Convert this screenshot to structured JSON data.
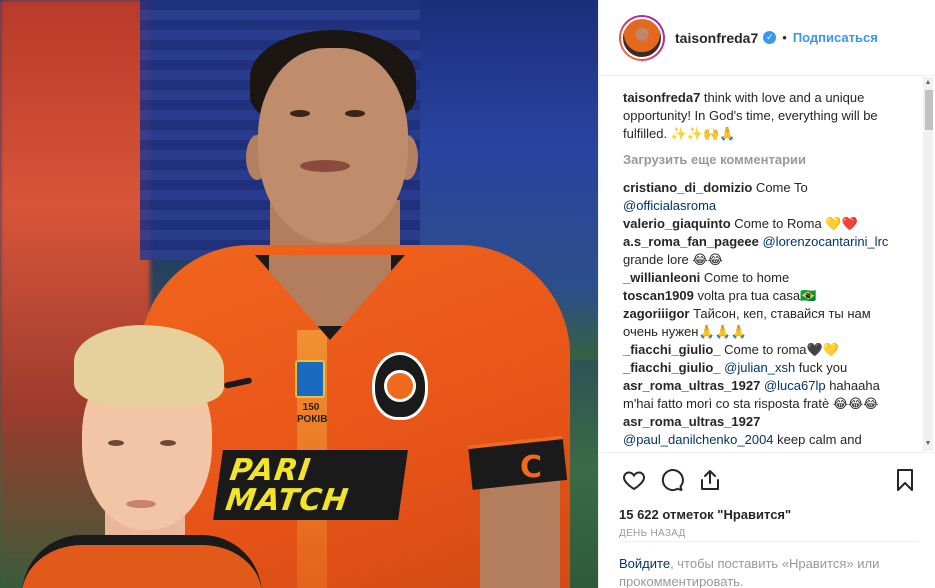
{
  "post": {
    "sponsor_line1": "PARI",
    "sponsor_line2": "MATCH",
    "badge_text": "150 РОКІВ"
  },
  "header": {
    "username": "taisonfreda7",
    "verified_icon": "check-icon",
    "separator": "•",
    "follow_label": "Подписаться"
  },
  "caption": {
    "username": "taisonfreda7",
    "text": " think with love and a unique opportunity! In God's time, everything will be fulfilled. ✨✨🙌🙏"
  },
  "load_more": "Загрузить еще комментарии",
  "comments": [
    {
      "user": "cristiano_di_domizio",
      "text": " Come To ",
      "mention": "@officialasroma",
      "after": ""
    },
    {
      "user": "valerio_giaquinto",
      "text": " Come to Roma 💛❤️",
      "mention": "",
      "after": ""
    },
    {
      "user": "a.s_roma_fan_pageee",
      "text": " ",
      "mention": "@lorenzocantarini_lrc",
      "after": " grande lore 😂😂"
    },
    {
      "user": "_willianleoni",
      "text": " Come to home",
      "mention": "",
      "after": ""
    },
    {
      "user": "toscan1909",
      "text": " volta pra tua casa🇧🇷",
      "mention": "",
      "after": ""
    },
    {
      "user": "zagoriiigor",
      "text": " Тайсон, кеп, ставайся ты нам очень нужен🙏🙏🙏",
      "mention": "",
      "after": ""
    },
    {
      "user": "_fiacchi_giulio_",
      "text": " Come to roma🖤💛",
      "mention": "",
      "after": ""
    },
    {
      "user": "_fiacchi_giulio_",
      "text": " ",
      "mention": "@julian_xsh",
      "after": " fuck you"
    },
    {
      "user": "asr_roma_ultras_1927",
      "text": " ",
      "mention": "@luca67lp",
      "after": " hahaaha m'hai fatto morì co sta risposta fratè 😂😂😂"
    },
    {
      "user": "asr_roma_ultras_1927",
      "text": "",
      "mention": "",
      "after": ""
    },
    {
      "user": "",
      "text": "",
      "mention": "@paul_danilchenko_2004",
      "after": " keep calm and"
    }
  ],
  "actions": {
    "like_icon": "heart-icon",
    "comment_icon": "comment-icon",
    "share_icon": "share-icon",
    "save_icon": "bookmark-icon"
  },
  "likes": "15 622 отметок \"Нравится\"",
  "time": "ДЕНЬ НАЗАД",
  "login": {
    "link": "Войдите",
    "rest": ", чтобы поставить «Нравится» или прокомментировать."
  },
  "colors": {
    "accent": "#3897f0",
    "mention": "#003569",
    "muted": "#999999",
    "jersey": "#e85418"
  }
}
